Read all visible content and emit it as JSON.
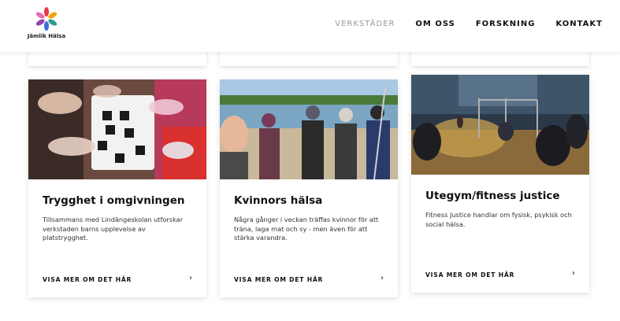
{
  "brand": {
    "name": "Jämlik Hälsa"
  },
  "nav": {
    "items": [
      {
        "label": "VERKSTÄDER",
        "active": true
      },
      {
        "label": "OM OSS",
        "active": false
      },
      {
        "label": "FORSKNING",
        "active": false
      },
      {
        "label": "KONTAKT",
        "active": false
      }
    ]
  },
  "cards": [
    {
      "title": "Trygghet i omgivningen",
      "text": "Tillsammans med Lindängeskolan utforskar verkstaden barns upplevelse av platstrygghet.",
      "link": "VISA MER OM DET HÄR",
      "image": "children-hands-sorting-tray"
    },
    {
      "title": "Kvinnors hälsa",
      "text": "Några gånger i veckan träffas kvinnor för att träna, laga mat och sy - men även för att stärka varandra.",
      "link": "VISA MER OM DET HÄR",
      "image": "women-group-selfie-by-water"
    },
    {
      "title": "Utegym/fitness justice",
      "text": "Fitness Justice handlar om fysisk, psykisk och social hälsa.",
      "link": "VISA MER OM DET HÄR",
      "image": "outdoor-gym-evening"
    }
  ],
  "colors": {
    "nav_active": "#9a9a9a",
    "text": "#111111",
    "logo_colors": [
      "#e63946",
      "#f4a300",
      "#2a9d8f",
      "#3a6fd8",
      "#8e44ad",
      "#e76fb0"
    ]
  }
}
